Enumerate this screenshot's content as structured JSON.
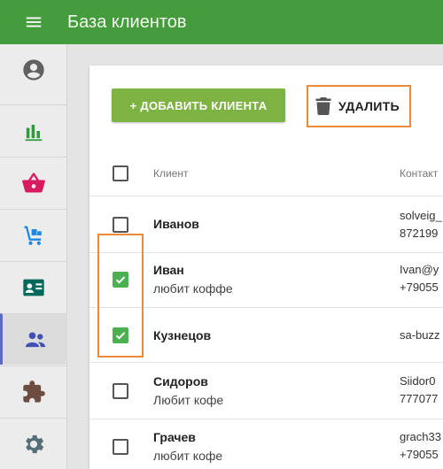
{
  "app": {
    "title": "База клиентов"
  },
  "colors": {
    "appbar": "#449c3c",
    "add_button": "#7cb342",
    "checkbox_checked": "#4caf50",
    "highlight": "#ec8a3a",
    "active_nav": "#5c6bc0"
  },
  "sidebar": {
    "items": [
      {
        "icon": "account-circle-icon"
      },
      {
        "icon": "bar-chart-icon"
      },
      {
        "icon": "shopping-basket-icon"
      },
      {
        "icon": "delivery-cart-icon"
      },
      {
        "icon": "contact-card-icon"
      },
      {
        "icon": "people-icon",
        "active": true
      },
      {
        "icon": "puzzle-icon"
      },
      {
        "icon": "settings-gear-icon"
      }
    ]
  },
  "toolbar": {
    "add_label": "+ ДОБАВИТЬ КЛИЕНТА",
    "delete_label": "УДАЛИТЬ"
  },
  "table": {
    "columns": {
      "client": "Клиент",
      "contacts": "Контакт"
    },
    "rows": [
      {
        "name": "Иванов",
        "note": "",
        "contact1": "solveig_",
        "contact2": "872199",
        "checked": false
      },
      {
        "name": "Иван",
        "note": "любит коффе",
        "contact1": "Ivan@y",
        "contact2": "+79055",
        "checked": true
      },
      {
        "name": "Кузнецов",
        "note": "",
        "contact1": "sa-buzz",
        "contact2": "",
        "checked": true
      },
      {
        "name": "Сидоров",
        "note": "Любит кофе",
        "contact1": "Siidor0",
        "contact2": "777077",
        "checked": false
      },
      {
        "name": "Грачев",
        "note": "любит кофе",
        "contact1": "grach33",
        "contact2": "+79055",
        "checked": false
      }
    ]
  }
}
